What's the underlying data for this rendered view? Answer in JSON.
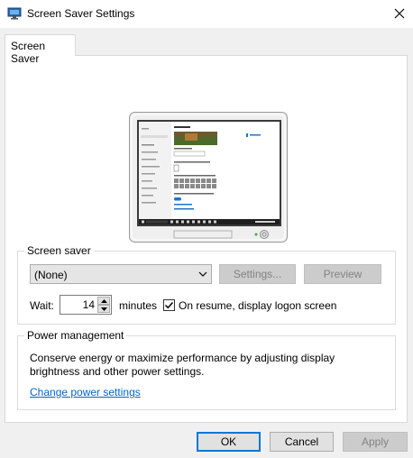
{
  "window": {
    "title": "Screen Saver Settings"
  },
  "tabs": [
    {
      "label": "Screen Saver"
    }
  ],
  "screen_saver": {
    "legend": "Screen saver",
    "selected": "(None)",
    "settings_label": "Settings...",
    "preview_label": "Preview",
    "wait_label": "Wait:",
    "wait_value": "14",
    "minutes_label": "minutes",
    "resume_checked": true,
    "resume_label": "On resume, display logon screen"
  },
  "power": {
    "legend": "Power management",
    "description_line1": "Conserve energy or maximize performance by adjusting display",
    "description_line2": "brightness and other power settings.",
    "link_label": "Change power settings"
  },
  "buttons": {
    "ok": "OK",
    "cancel": "Cancel",
    "apply": "Apply"
  },
  "colors": {
    "accent": "#0078d7",
    "link": "#0066cc",
    "dialog_bg": "#f0f0f0"
  }
}
